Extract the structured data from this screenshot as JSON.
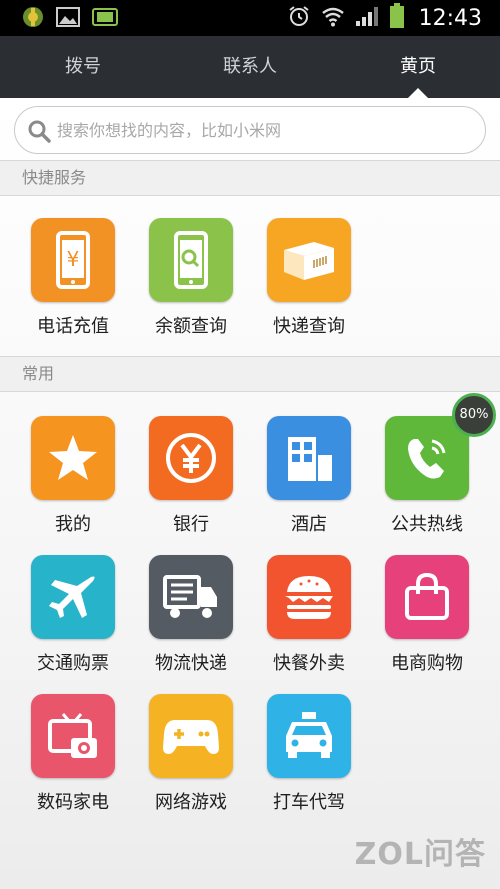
{
  "status_bar": {
    "time": "12:43",
    "battery_color": "#8bc34a"
  },
  "tabs": [
    {
      "label": "拨号"
    },
    {
      "label": "联系人"
    },
    {
      "label": "黄页"
    }
  ],
  "search": {
    "placeholder": "搜索你想找的内容，比如小米网"
  },
  "sections": {
    "quick": {
      "title": "快捷服务"
    },
    "common": {
      "title": "常用"
    }
  },
  "quick_services": [
    {
      "label": "电话充值",
      "icon": "phone-recharge-icon",
      "color": "#f39224"
    },
    {
      "label": "余额查询",
      "icon": "balance-search-icon",
      "color": "#8bc34a"
    },
    {
      "label": "快递查询",
      "icon": "package-icon",
      "color": "#f6a623"
    }
  ],
  "common_services": [
    {
      "label": "我的",
      "icon": "star-icon",
      "color": "#f5941f"
    },
    {
      "label": "银行",
      "icon": "yuan-coin-icon",
      "color": "#f26b21"
    },
    {
      "label": "酒店",
      "icon": "building-icon",
      "color": "#3b8fe0"
    },
    {
      "label": "公共热线",
      "icon": "phone-call-icon",
      "color": "#5fb83a"
    },
    {
      "label": "交通购票",
      "icon": "airplane-icon",
      "color": "#27b3c9"
    },
    {
      "label": "物流快递",
      "icon": "truck-icon",
      "color": "#555b63"
    },
    {
      "label": "快餐外卖",
      "icon": "burger-icon",
      "color": "#f2542f"
    },
    {
      "label": "电商购物",
      "icon": "shopping-bag-icon",
      "color": "#e7417b"
    },
    {
      "label": "数码家电",
      "icon": "tv-camera-icon",
      "color": "#e9566b"
    },
    {
      "label": "网络游戏",
      "icon": "gamepad-icon",
      "color": "#f5b323"
    },
    {
      "label": "打车代驾",
      "icon": "taxi-icon",
      "color": "#2fb3e6"
    }
  ],
  "floating_badge": {
    "text": "80%"
  },
  "watermark": {
    "text": "ZOL问答"
  }
}
